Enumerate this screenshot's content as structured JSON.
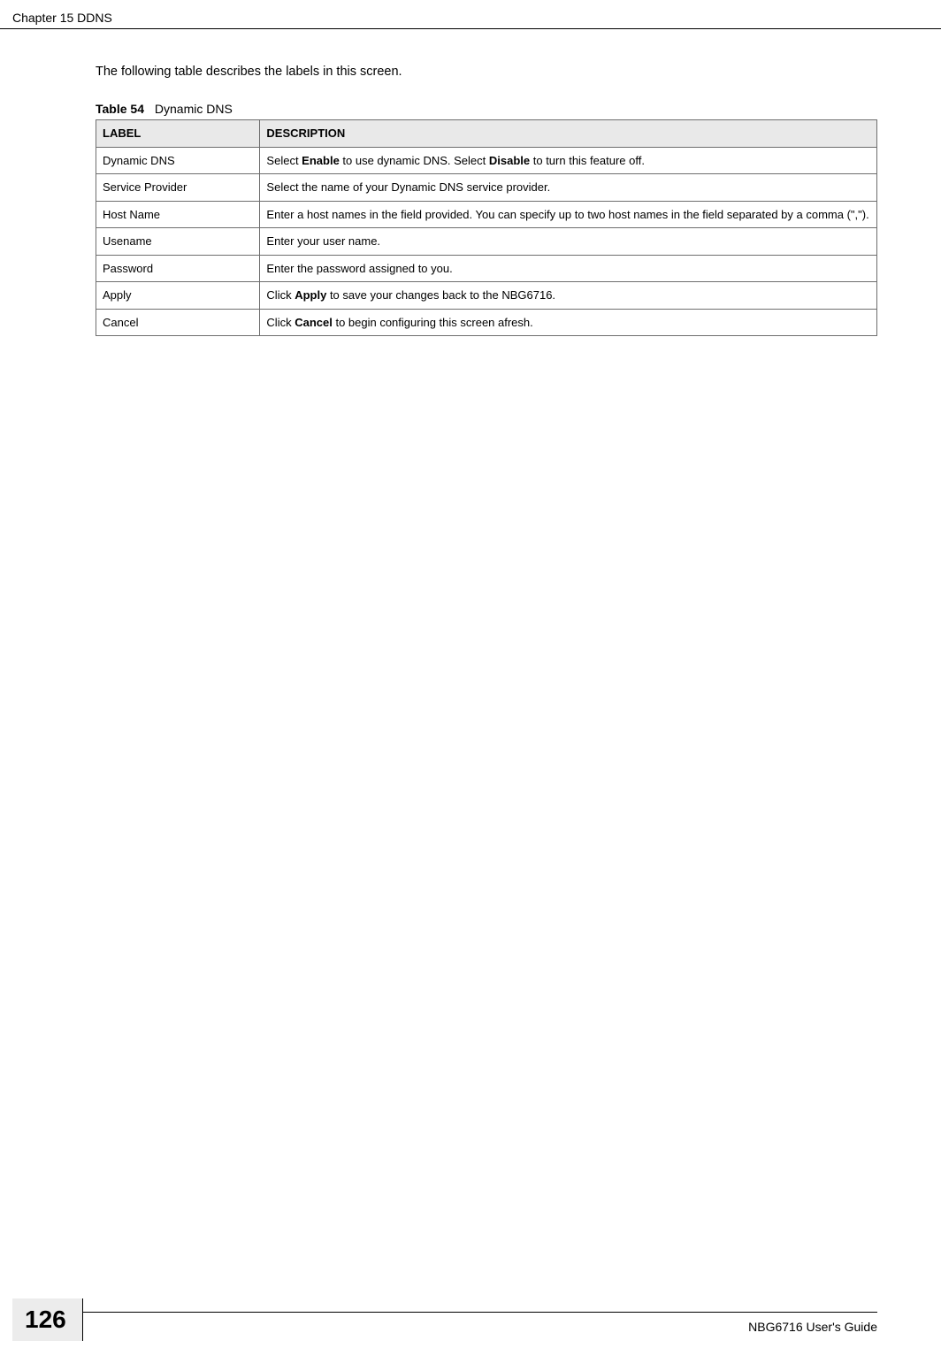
{
  "header": {
    "chapter": "Chapter 15 DDNS"
  },
  "intro": "The following table describes the labels in this screen.",
  "table_caption": {
    "number": "Table 54",
    "title": "Dynamic DNS"
  },
  "table": {
    "headers": {
      "label": "LABEL",
      "description": "DESCRIPTION"
    },
    "rows": [
      {
        "label": "Dynamic DNS",
        "desc_segments": [
          {
            "t": "Select "
          },
          {
            "t": "Enable",
            "b": true
          },
          {
            "t": " to use dynamic DNS. Select "
          },
          {
            "t": "Disable",
            "b": true
          },
          {
            "t": " to turn this feature off."
          }
        ]
      },
      {
        "label": "Service Provider",
        "desc_segments": [
          {
            "t": "Select the name of your Dynamic DNS service provider."
          }
        ]
      },
      {
        "label": "Host Name",
        "desc_segments": [
          {
            "t": "Enter a host names in the field provided. You can specify up to two host names in the field separated by a comma (\",\")."
          }
        ]
      },
      {
        "label": "Usename",
        "desc_segments": [
          {
            "t": "Enter your user name."
          }
        ]
      },
      {
        "label": "Password",
        "desc_segments": [
          {
            "t": "Enter the password assigned to you."
          }
        ]
      },
      {
        "label": "Apply",
        "desc_segments": [
          {
            "t": "Click "
          },
          {
            "t": "Apply",
            "b": true
          },
          {
            "t": " to save your changes back to the NBG6716."
          }
        ]
      },
      {
        "label": "Cancel",
        "desc_segments": [
          {
            "t": "Click "
          },
          {
            "t": "Cancel",
            "b": true
          },
          {
            "t": " to begin configuring this screen afresh."
          }
        ]
      }
    ]
  },
  "footer": {
    "page_number": "126",
    "guide": "NBG6716 User's Guide"
  }
}
